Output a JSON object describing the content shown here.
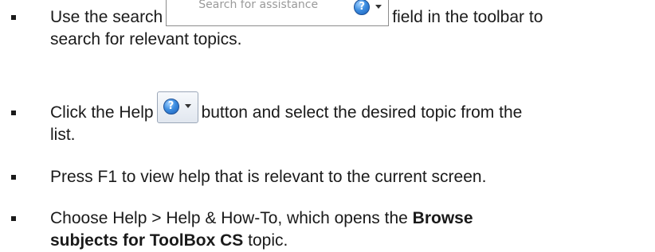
{
  "items": [
    {
      "text_before": "Use the search",
      "search_placeholder": "Search for assistance",
      "text_after_line1": "field in the toolbar to",
      "text_line2": "search for relevant topics."
    },
    {
      "text_before": "Click the Help",
      "text_after_line1": "button and select the desired topic from the",
      "text_line2": "list."
    },
    {
      "text": "Press F1 to view help that is relevant to the current screen."
    },
    {
      "text_before": "Choose Help > Help & How-To, which opens the",
      "bold1": "Browse",
      "bold2": "subjects for ToolBox CS",
      "text_after": "topic."
    }
  ],
  "icons": {
    "help_glyph": "?",
    "help_icon": "help-question-circle",
    "dropdown_icon": "caret-down"
  }
}
